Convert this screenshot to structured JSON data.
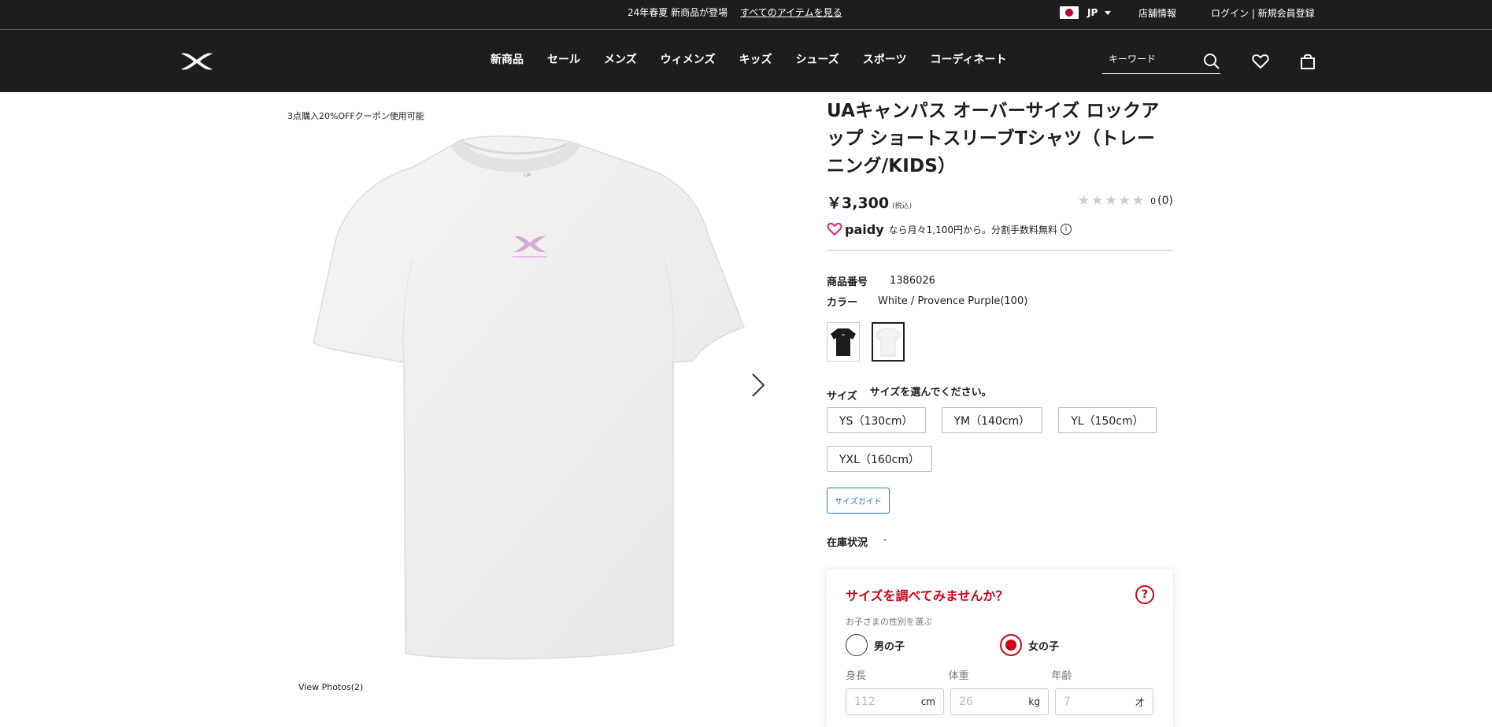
{
  "topbar": {
    "promo_text": "24年春夏 新商品が登場",
    "promo_link": "すべてのアイテムを見る",
    "region": "JP",
    "store_info": "店舗情報",
    "login": "ログイン | 新規会員登録"
  },
  "header": {
    "nav": [
      "新商品",
      "セール",
      "メンズ",
      "ウィメンズ",
      "キッズ",
      "シューズ",
      "スポーツ",
      "コーディネート"
    ],
    "search_placeholder": "キーワード"
  },
  "gallery": {
    "coupon": "3点購入20%OFFクーポン使用可能",
    "view_photos": "View Photos(2)"
  },
  "product": {
    "title": "UAキャンパス オーバーサイズ ロックアップ ショートスリーブTシャツ（トレーニング/KIDS）",
    "price": "￥3,300",
    "tax": "(税込)",
    "rating_count": "0",
    "rating_paren": "(0)",
    "paidy_brand": "paidy",
    "paidy_text": "なら月々1,100円から。分割手数料無料",
    "item_no_label": "商品番号",
    "item_no": "1386026",
    "color_label": "カラー",
    "color": "White / Provence Purple(100)",
    "size_label": "サイズ",
    "size_prompt": "サイズを選んでください。",
    "sizes": [
      "YS（130cm）",
      "YM（140cm）",
      "YL（150cm）",
      "YXL（160cm）"
    ],
    "size_guide": "サイズガイド",
    "stock_label": "在庫状況",
    "stock_value": "-"
  },
  "finder": {
    "title": "サイズを調べてみませんか？",
    "subtitle": "お子さまの性別を選ぶ",
    "boy": "男の子",
    "girl": "女の子",
    "height_label": "身長",
    "weight_label": "体重",
    "age_label": "年齢",
    "height_ph": "112",
    "height_unit": "cm",
    "weight_ph": "26",
    "weight_unit": "kg",
    "age_ph": "7",
    "age_unit": "才"
  },
  "colors": {
    "accent_red": "#d0021b",
    "header_bg": "#1d1d1d",
    "guide_blue": "#1f7ac1",
    "logo_pink": "#d9a7d8"
  }
}
